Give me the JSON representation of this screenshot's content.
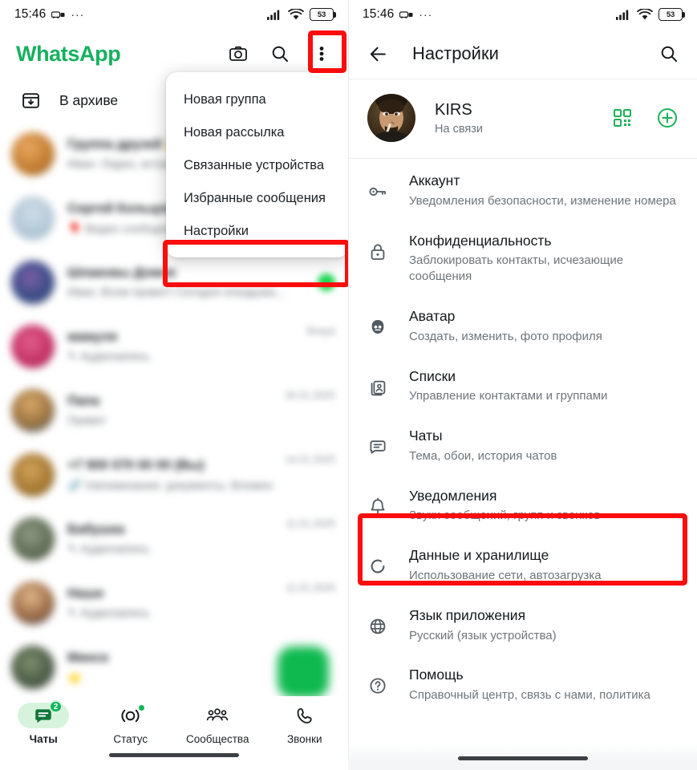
{
  "status_bar": {
    "time": "15:46",
    "dots": "···",
    "battery_level": "53",
    "icons": [
      "car-lock-icon",
      "more-dots-icon",
      "signal-icon",
      "wifi-icon",
      "battery-icon"
    ]
  },
  "left_panel": {
    "app_title": "WhatsApp",
    "brand_color": "#15b15e",
    "actions": [
      {
        "name": "camera-icon",
        "label": "Камера"
      },
      {
        "name": "search-icon",
        "label": "Поиск"
      },
      {
        "name": "overflow-menu-icon",
        "label": "Ещё"
      }
    ],
    "archived": {
      "label": "В архиве",
      "icon": "archive-icon"
    },
    "chats": [
      {
        "name": "",
        "message": "",
        "time": "",
        "blurred": true
      },
      {
        "name": "",
        "message": "",
        "time": "",
        "blurred": true
      },
      {
        "name": "",
        "message": "",
        "time": "",
        "blurred": true,
        "unread": true
      },
      {
        "name": "",
        "message": "",
        "time": "",
        "blurred": true
      },
      {
        "name": "",
        "message": "",
        "time": "",
        "blurred": true
      },
      {
        "name": "",
        "message": "",
        "time": "",
        "blurred": true
      },
      {
        "name": "",
        "message": "",
        "time": "",
        "blurred": true
      },
      {
        "name": "",
        "message": "",
        "time": "",
        "blurred": true
      },
      {
        "name": "",
        "message": "",
        "time": "",
        "blurred": true
      }
    ],
    "fab": {
      "name": "new-chat-fab",
      "color": "#0fb94f"
    },
    "bottom_nav": [
      {
        "label": "Чаты",
        "icon": "chats-icon",
        "active": true,
        "badge": "2"
      },
      {
        "label": "Статус",
        "icon": "status-icon",
        "active": false,
        "dot": true
      },
      {
        "label": "Сообщества",
        "icon": "communities-icon",
        "active": false
      },
      {
        "label": "Звонки",
        "icon": "calls-icon",
        "active": false
      }
    ]
  },
  "overflow_menu": {
    "items": [
      {
        "label": "Новая группа"
      },
      {
        "label": "Новая рассылка"
      },
      {
        "label": "Связанные устройства"
      },
      {
        "label": "Избранные сообщения"
      },
      {
        "label": "Настройки",
        "highlighted": true
      }
    ]
  },
  "right_panel": {
    "title": "Настройки",
    "back_icon": "back-arrow-icon",
    "search_icon": "search-icon",
    "profile": {
      "name": "KIRS",
      "status": "На связи",
      "avatar": "profile-avatar",
      "qr_icon": "qr-code-icon",
      "add_icon": "add-account-icon"
    },
    "items": [
      {
        "icon": "key-icon",
        "title": "Аккаунт",
        "subtitle": "Уведомления безопасности, изменение номера"
      },
      {
        "icon": "lock-icon",
        "title": "Конфиденциальность",
        "subtitle": "Заблокировать контакты, исчезающие сообщения"
      },
      {
        "icon": "avatar-face-icon",
        "title": "Аватар",
        "subtitle": "Создать, изменить, фото профиля"
      },
      {
        "icon": "lists-icon",
        "title": "Списки",
        "subtitle": "Управление контактами и группами"
      },
      {
        "icon": "chat-bubble-icon",
        "title": "Чаты",
        "subtitle": "Тема, обои, история чатов"
      },
      {
        "icon": "bell-icon",
        "title": "Уведомления",
        "subtitle": "Звуки сообщений, групп и звонков",
        "highlighted": true
      },
      {
        "icon": "storage-icon",
        "title": "Данные и хранилище",
        "subtitle": "Использование сети, автозагрузка"
      },
      {
        "icon": "globe-icon",
        "title": "Язык приложения",
        "subtitle": "Русский (язык устройства)"
      },
      {
        "icon": "help-icon",
        "title": "Помощь",
        "subtitle": "Справочный центр, связь с нами, политика"
      }
    ]
  },
  "annotations": {
    "highlight_color": "#fb0d0d",
    "boxes": [
      "overflow-menu-button",
      "settings-menu-item",
      "notifications-settings-item"
    ]
  }
}
